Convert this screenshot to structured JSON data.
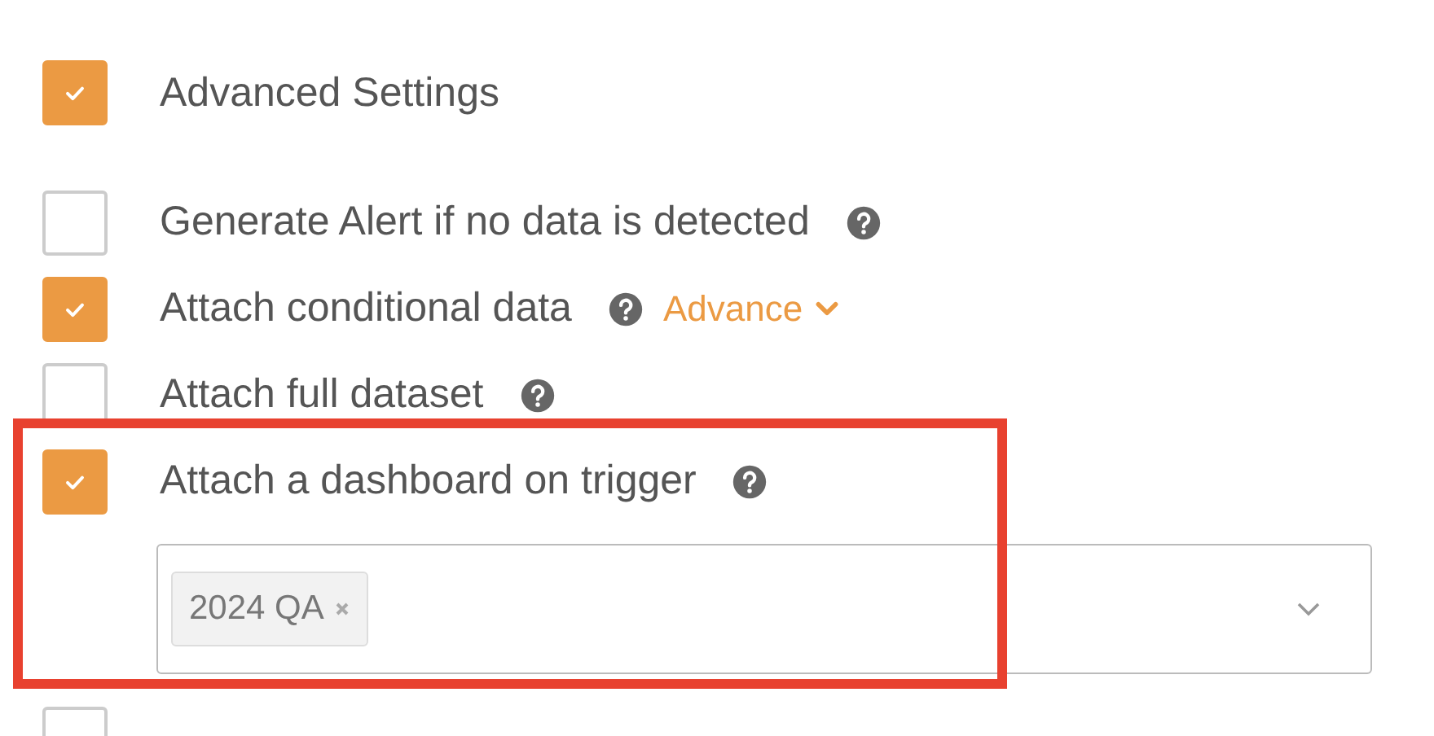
{
  "header": {
    "label": "Advanced Settings",
    "checked": true
  },
  "options": [
    {
      "label": "Generate Alert if no data is detected",
      "checked": false,
      "help": true
    },
    {
      "label": "Attach conditional data",
      "checked": true,
      "help": true,
      "link": "Advance"
    },
    {
      "label": "Attach full dataset",
      "checked": false,
      "help": true
    },
    {
      "label": "Attach a dashboard on trigger",
      "checked": true,
      "help": true,
      "select": {
        "tags": [
          "2024 QA"
        ]
      },
      "highlighted": true
    }
  ],
  "next_option": {
    "checked": false
  }
}
